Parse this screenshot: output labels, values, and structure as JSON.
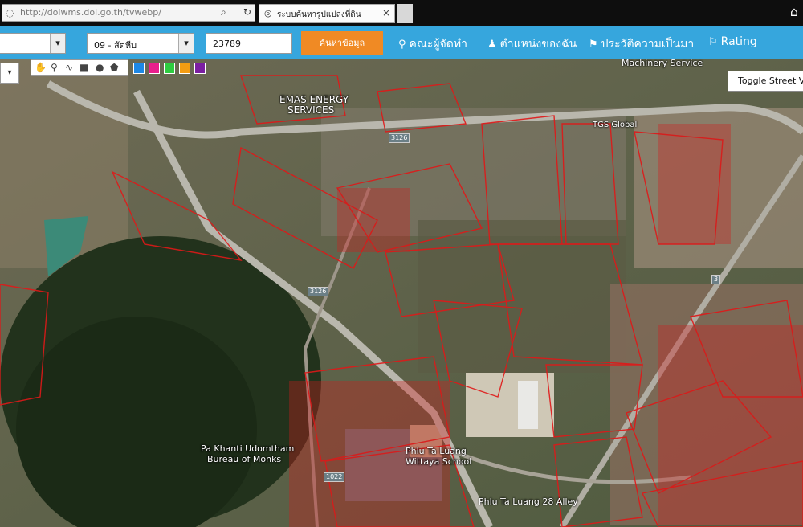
{
  "browser": {
    "url": "http://dolwms.dol.go.th/tvwebp/",
    "tab_title": "ระบบค้นหารูปแปลงที่ดิน",
    "tab_close": "×",
    "home_icon": "home-icon"
  },
  "toolbar": {
    "province_select": "",
    "district_select": "09 - สัตหีบ",
    "parcel_number": "23789",
    "search_label": "ค้นหาข้อมูล",
    "nav": [
      {
        "icon": "⚲",
        "label": "คณะผู้จัดทำ"
      },
      {
        "icon": "♟",
        "label": "ตำแหน่งของฉัน"
      },
      {
        "icon": "⚑",
        "label": "ประวัติความเป็นมา"
      },
      {
        "icon": "⚐",
        "label": "Rating"
      }
    ]
  },
  "map": {
    "toggle_street_view": "Toggle Street View",
    "draw_colors": [
      "#1e88e5",
      "#e91e8c",
      "#2ecc40",
      "#f39c12",
      "#7b1fa2"
    ],
    "labels": {
      "emas": "EMAS ENERGY",
      "emas2": "SERVICES",
      "machinery": "Machinery Service",
      "tgs": "TGS Global",
      "pa_khanti": "Pa Khanti Udomtham",
      "bureau": "Bureau of Monks",
      "phlu_school": "Phlu Ta Luang",
      "phlu_school2": "Wittaya School",
      "phlu_alley": "Phlu Ta Luang 28 Alley"
    },
    "road_shields": {
      "r3126": "3126",
      "r1022": "1022",
      "r3": "3"
    }
  }
}
